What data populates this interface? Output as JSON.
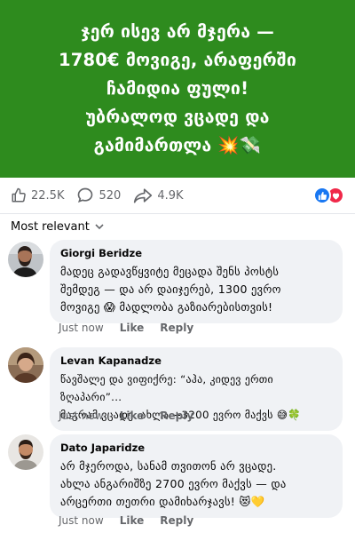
{
  "post": {
    "banner_lines": [
      "ჯერ ისევ არ მჯერა —",
      "1780€ მოვიგე, არაფერში",
      "ჩამიდია ფული!",
      "უბრალოდ ვცადე და",
      "გამიმართლა 💥💸"
    ],
    "background_color": "#2e8b1e",
    "likes_count": "22.5K",
    "comments_count": "520",
    "shares_count": "4.9K",
    "reaction_icons": [
      "like-icon",
      "love-icon"
    ]
  },
  "comments_section": {
    "sort_label": "Most relevant",
    "comments": [
      {
        "author": "Giorgi Beridze",
        "text_lines": [
          "მადეც გადავწყვიტე მეცადა შენს პოსტს",
          "შემდეგ — და არ დაიჯერებ, 1300 ევრო",
          "მოვიგე 😱 მადლობა გაზიარებისთვის!"
        ],
        "time": "Just now",
        "like_label": "Like",
        "reply_label": "Reply"
      },
      {
        "author": "Levan Kapanadze",
        "text_lines": [
          "წავშალე და ვიფიქრე: “აჰა, კიდევ ერთი ზღაპარი”...",
          "მაგრამ ვცადე. ახლა +3200 ევრო მაქვს 😅🍀"
        ],
        "time": "Just now",
        "like_label": "Like",
        "reply_label": "Reply"
      },
      {
        "author": "Dato Japaridze",
        "text_lines": [
          "არ მჯეროდა, სანამ თვითონ არ ვცადე.",
          "ახლა ანგარიშზე 2700 ევრო მაქვს — და",
          "არცერთი თეთრი დამიხარჯავს! 😻💛"
        ],
        "time": "Just now",
        "like_label": "Like",
        "reply_label": "Reply"
      }
    ]
  }
}
